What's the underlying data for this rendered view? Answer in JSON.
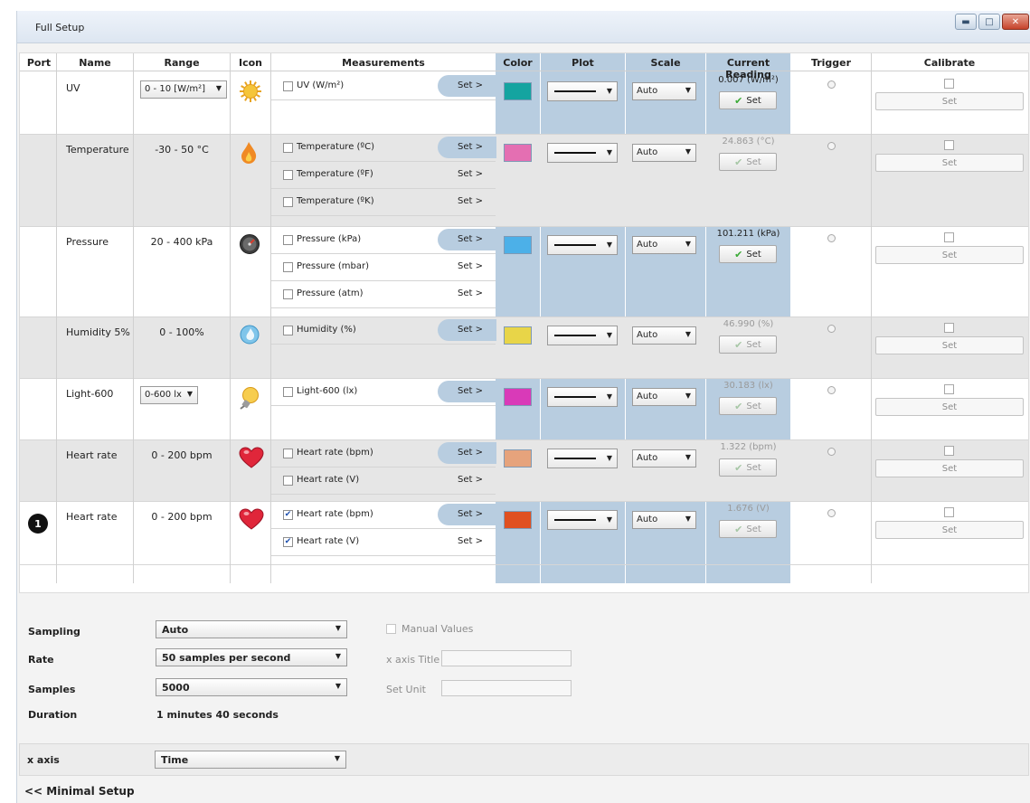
{
  "window": {
    "title": "Full Setup",
    "buttons": [
      "minimize",
      "maximize",
      "close"
    ]
  },
  "columns": [
    "Port",
    "Name",
    "Range",
    "Icon",
    "Measurements",
    "Color",
    "Plot",
    "Scale",
    "Current Reading",
    "Trigger",
    "Calibrate"
  ],
  "rows": [
    {
      "port": "",
      "name": "UV",
      "range": "0 - 10 [W/m²]",
      "range_is_dropdown": true,
      "icon": "sun-icon",
      "measurements": [
        {
          "label": "UV (W/m²)",
          "set": "Set >",
          "checked": false
        }
      ],
      "color": "#14a4a0",
      "scale": "Auto",
      "reading": "0.007 (W/m²)",
      "reading_active": true,
      "set_label": "Set",
      "calibrate_label": "Set"
    },
    {
      "port": "",
      "name": "Temperature",
      "range": "-30 - 50 °C",
      "range_is_dropdown": false,
      "icon": "flame-icon",
      "measurements": [
        {
          "label": "Temperature (ºC)",
          "set": "Set >",
          "checked": false
        },
        {
          "label": "Temperature (ºF)",
          "set": "Set >",
          "checked": false
        },
        {
          "label": "Temperature (ºK)",
          "set": "Set >",
          "checked": false
        }
      ],
      "color": "#e46fb2",
      "scale": "Auto",
      "reading": "24.863 (°C)",
      "reading_active": false,
      "set_label": "Set",
      "calibrate_label": "Set"
    },
    {
      "port": "",
      "name": "Pressure",
      "range": "20 - 400 kPa",
      "range_is_dropdown": false,
      "icon": "gauge-icon",
      "measurements": [
        {
          "label": "Pressure (kPa)",
          "set": "Set >",
          "checked": false
        },
        {
          "label": "Pressure (mbar)",
          "set": "Set >",
          "checked": false
        },
        {
          "label": "Pressure (atm)",
          "set": "Set >",
          "checked": false
        }
      ],
      "color": "#4cb0e8",
      "scale": "Auto",
      "reading": "101.211 (kPa)",
      "reading_active": true,
      "set_label": "Set",
      "calibrate_label": "Set"
    },
    {
      "port": "",
      "name": "Humidity 5%",
      "range": "0 - 100%",
      "range_is_dropdown": false,
      "icon": "water-drop-icon",
      "measurements": [
        {
          "label": "Humidity (%)",
          "set": "Set >",
          "checked": false
        }
      ],
      "color": "#e8d548",
      "scale": "Auto",
      "reading": "46.990 (%)",
      "reading_active": false,
      "set_label": "Set",
      "calibrate_label": "Set"
    },
    {
      "port": "",
      "name": "Light-600",
      "range": "0-600 lx",
      "range_is_dropdown": true,
      "icon": "light-bulb-icon",
      "measurements": [
        {
          "label": "Light-600 (lx)",
          "set": "Set >",
          "checked": false
        }
      ],
      "color": "#d93ab8",
      "scale": "Auto",
      "reading": "30.183 (lx)",
      "reading_active": false,
      "set_label": "Set",
      "calibrate_label": "Set"
    },
    {
      "port": "",
      "name": "Heart rate",
      "range": "0 - 200 bpm",
      "range_is_dropdown": false,
      "icon": "heart-icon",
      "measurements": [
        {
          "label": "Heart rate (bpm)",
          "set": "Set >",
          "checked": false
        },
        {
          "label": "Heart rate (V)",
          "set": "Set >",
          "checked": false
        }
      ],
      "color": "#e6a37c",
      "scale": "Auto",
      "reading": "1.322 (bpm)",
      "reading_active": false,
      "set_label": "Set",
      "calibrate_label": "Set"
    },
    {
      "port": "1",
      "name": "Heart rate",
      "range": "0 - 200 bpm",
      "range_is_dropdown": false,
      "icon": "heart-icon",
      "measurements": [
        {
          "label": "Heart rate (bpm)",
          "set": "Set >",
          "checked": true
        },
        {
          "label": "Heart rate (V)",
          "set": "Set >",
          "checked": true
        }
      ],
      "color": "#e05020",
      "scale": "Auto",
      "reading": "1.676 (V)",
      "reading_active": false,
      "set_label": "Set",
      "calibrate_label": "Set"
    }
  ],
  "settings": {
    "sampling_label": "Sampling",
    "sampling_value": "Auto",
    "rate_label": "Rate",
    "rate_value": "50 samples per second",
    "samples_label": "Samples",
    "samples_value": "5000",
    "duration_label": "Duration",
    "duration_value": "1 minutes 40 seconds",
    "manual_values_label": "Manual Values",
    "x_axis_title_label": "x axis Title",
    "set_unit_label": "Set Unit",
    "x_axis_label": "x axis",
    "x_axis_value": "Time"
  },
  "footer": {
    "minimal_setup": "<< Minimal Setup"
  }
}
